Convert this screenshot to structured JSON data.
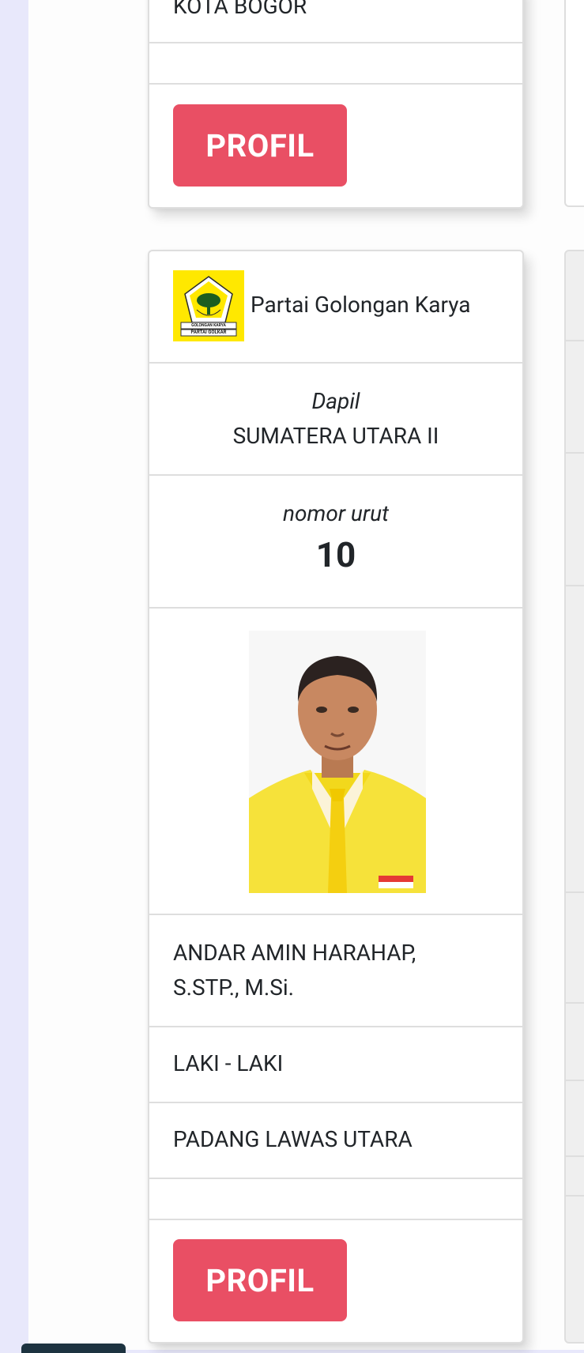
{
  "top_card": {
    "location": "KOTA BOGOR",
    "profil_button": "PROFIL"
  },
  "candidate_card": {
    "party": {
      "name": "Partai Golongan Karya",
      "logo_text_top": "GOLONGAN KARYA",
      "logo_text_bottom": "PARTAI GOLKAR"
    },
    "dapil": {
      "label": "Dapil",
      "value": "SUMATERA UTARA II"
    },
    "nomor_urut": {
      "label": "nomor urut",
      "value": "10"
    },
    "name_line1": "ANDAR AMIN HARAHAP,",
    "name_line2": "S.STP., M.Si.",
    "gender": "LAKI - LAKI",
    "domicile": "PADANG LAWAS UTARA",
    "profil_button": "PROFIL"
  }
}
